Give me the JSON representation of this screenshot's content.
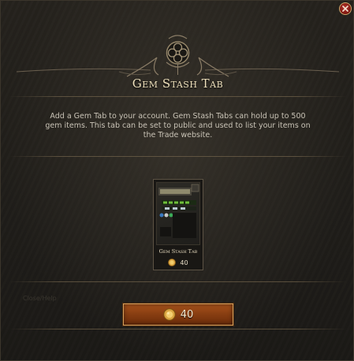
{
  "dialog": {
    "title": "Gem Stash Tab",
    "description": "Add a Gem Tab to your account. Gem Stash Tabs can hold up to 500 gem items. This tab can be set to public and used to list your items on the Trade website.",
    "faded_label": "Close/Help"
  },
  "item": {
    "name": "Gem Stash Tab",
    "price": "40",
    "currency_icon": "gold-coin-icon"
  },
  "purchase_button": {
    "price": "40",
    "currency_icon": "gold-coin-icon"
  },
  "colors": {
    "title": "#f0e2bd",
    "button": "#8a3f12",
    "button_border": "#d7a15c",
    "close": "#b8342a"
  }
}
